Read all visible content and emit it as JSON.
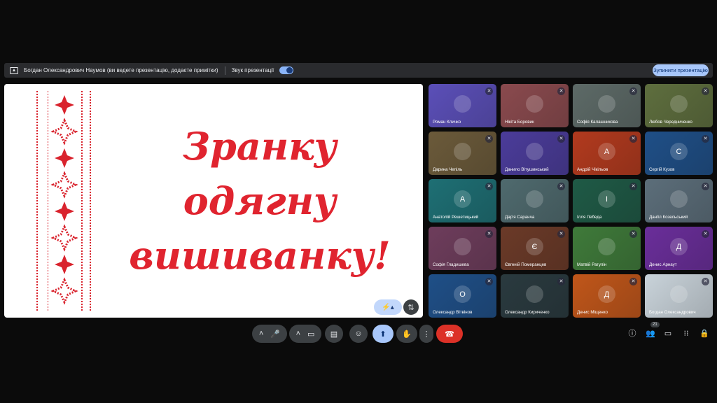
{
  "topbar": {
    "presenter_text": "Богдан Олександрович Наумов (ви ведете презентацію, додаєте примітки)",
    "sound_label": "Звук презентації",
    "stop_button": "Зупинити презентацію"
  },
  "slide": {
    "line1": "Зранку",
    "line2": "одягну",
    "line3": "вишиванку!"
  },
  "participants": [
    {
      "name": "Роман Кличко",
      "avatar": "",
      "bg": "#5b4fb8"
    },
    {
      "name": "Нікіта Боровик",
      "avatar": "",
      "bg": "#8a4a4e"
    },
    {
      "name": "Софія Калашникова",
      "avatar": "",
      "bg": "#5d6a67"
    },
    {
      "name": "Любов Чередниченко",
      "avatar": "",
      "bg": "#5e6e3e"
    },
    {
      "name": "Дарина Чепіль",
      "avatar": "",
      "bg": "#6b5a3a"
    },
    {
      "name": "Данило Вітушинський",
      "avatar": "",
      "bg": "#4b3c9a"
    },
    {
      "name": "Андрій Чікільов",
      "avatar": "А",
      "bg": "#b23a1e"
    },
    {
      "name": "Сергій Кузов",
      "avatar": "С",
      "bg": "#1f4f87"
    },
    {
      "name": "Анатолій Решетицький",
      "avatar": "А",
      "bg": "#1e6f74"
    },
    {
      "name": "Дар'я Саранча",
      "avatar": "",
      "bg": "#4f6a6e"
    },
    {
      "name": "Ілля Лебеда",
      "avatar": "І",
      "bg": "#1f5a46"
    },
    {
      "name": "Даніїл Козельський",
      "avatar": "",
      "bg": "#5c6e7a"
    },
    {
      "name": "Софія Гладишева",
      "avatar": "",
      "bg": "#6e3d5c"
    },
    {
      "name": "Євгеній Померанцев",
      "avatar": "Є",
      "bg": "#6b3a28"
    },
    {
      "name": "Матвій Рагулін",
      "avatar": "",
      "bg": "#3f7a3a"
    },
    {
      "name": "Денис Арнаут",
      "avatar": "Д",
      "bg": "#6a2e9a"
    },
    {
      "name": "Олександр Вітвінов",
      "avatar": "О",
      "bg": "#1f4f87"
    },
    {
      "name": "Олександр Кириченко",
      "avatar": "",
      "bg": "#2a3a3f"
    },
    {
      "name": "Денис Міщенко",
      "avatar": "Д",
      "bg": "#c0561a"
    },
    {
      "name": "Богдан Олександрович",
      "avatar": "",
      "bg": "#c9d3da"
    }
  ],
  "participant_count": "21"
}
